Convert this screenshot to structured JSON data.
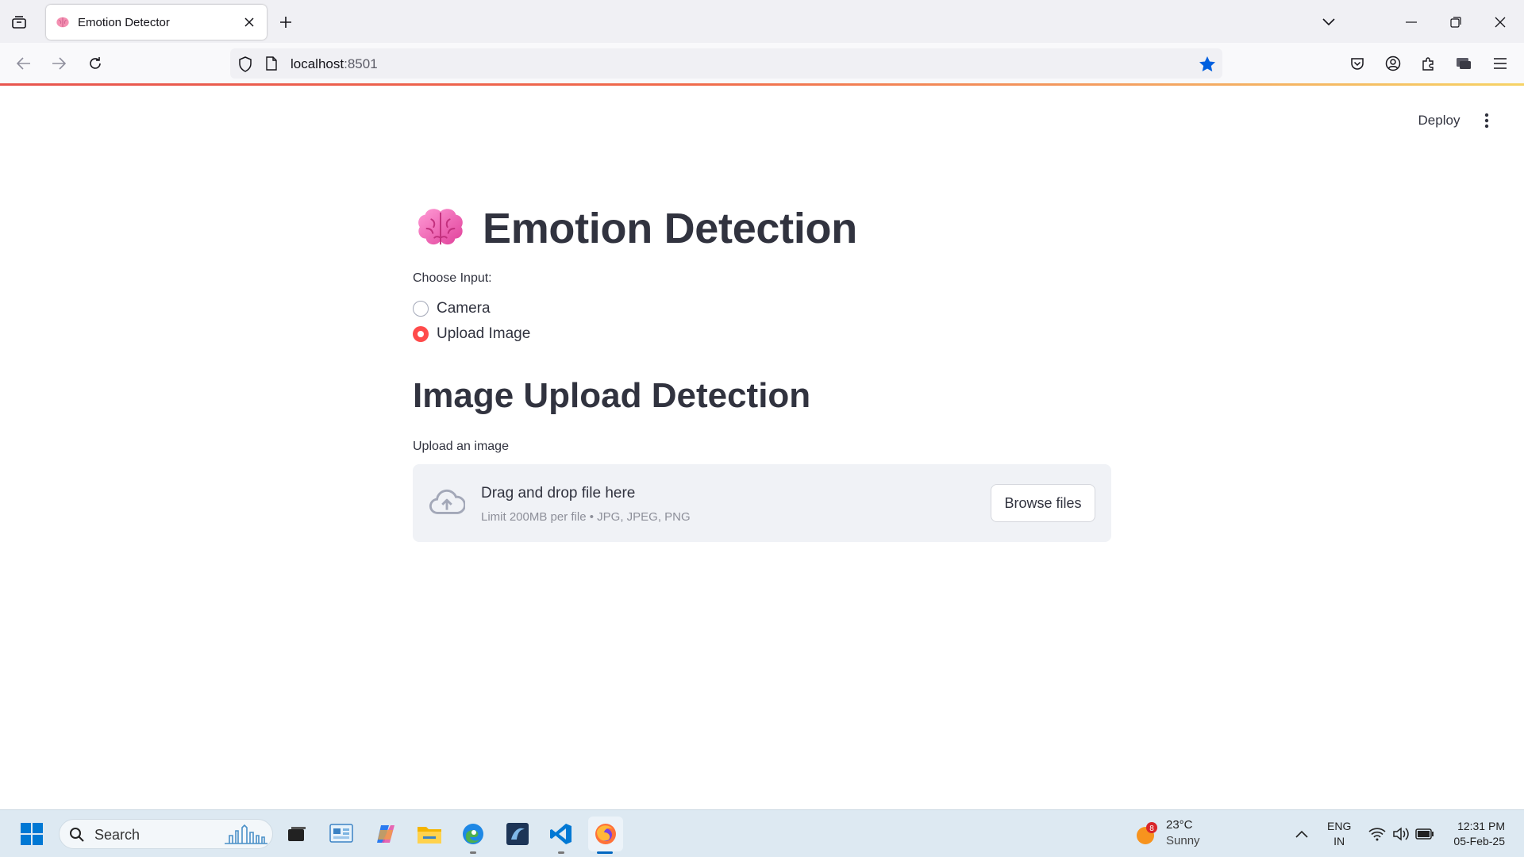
{
  "browser": {
    "tab_title": "Emotion Detector",
    "url_host": "localhost",
    "url_port": ":8501",
    "accent": "#0060df"
  },
  "app": {
    "deploy_label": "Deploy",
    "title": "Emotion Detection",
    "title_icon": "brain-emoji",
    "radio": {
      "label": "Choose Input:",
      "options": [
        {
          "label": "Camera",
          "checked": false
        },
        {
          "label": "Upload Image",
          "checked": true
        }
      ],
      "accent": "#ff4b4b"
    },
    "section_title": "Image Upload Detection",
    "uploader": {
      "label": "Upload an image",
      "drag_text": "Drag and drop file here",
      "limit_text": "Limit 200MB per file • JPG, JPEG, PNG",
      "browse_label": "Browse files"
    }
  },
  "taskbar": {
    "search_placeholder": "Search",
    "weather_badge": "8",
    "weather_temp": "23°C",
    "weather_cond": "Sunny",
    "lang_line1": "ENG",
    "lang_line2": "IN",
    "time": "12:31 PM",
    "date": "05-Feb-25"
  }
}
